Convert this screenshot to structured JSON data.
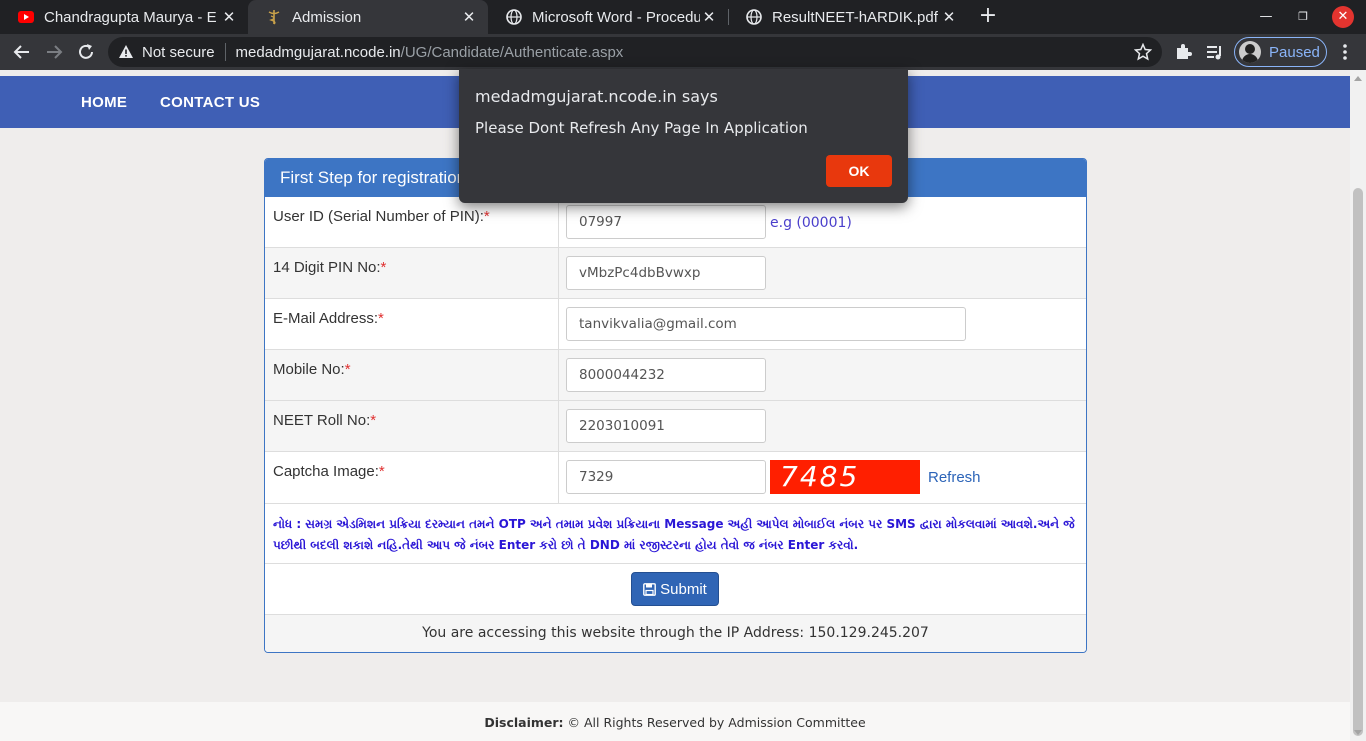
{
  "browser": {
    "tabs": [
      {
        "title": "Chandragupta Maurya - E",
        "icon": "youtube-icon"
      },
      {
        "title": "Admission",
        "icon": "caduceus-icon"
      },
      {
        "title": "Microsoft Word - Procedu",
        "icon": "globe-icon"
      },
      {
        "title": "ResultNEET-hARDIK.pdf",
        "icon": "globe-icon"
      }
    ],
    "active_tab_index": 1,
    "address": {
      "security_label": "Not secure",
      "host": "medadmgujarat.ncode.in",
      "path": "/UG/Candidate/Authenticate.aspx"
    },
    "profile_label": "Paused"
  },
  "nav": {
    "home": "HOME",
    "contact": "CONTACT US"
  },
  "form": {
    "heading": "First Step for registration",
    "required_mark": "*",
    "fields": [
      {
        "label": "User ID (Serial Number of PIN):",
        "value": "07997",
        "hint": "e.g (00001)"
      },
      {
        "label": "14 Digit PIN No:",
        "value": "vMbzPc4dbBvwxp"
      },
      {
        "label": "E-Mail Address:",
        "value": "tanvikvalia@gmail.com"
      },
      {
        "label": "Mobile No:",
        "value": "8000044232"
      },
      {
        "label": "NEET Roll No:",
        "value": "2203010091"
      },
      {
        "label": "Captcha Image:",
        "value": "7329",
        "captcha_text": "7485",
        "refresh_label": "Refresh"
      }
    ],
    "note": "નોધ : સમગ્ર એડમિશન પ્રક્રિયા દરમ્યાન તમને OTP અને તમામ પ્રવેશ પ્રક્રિયાના Message અહી આપેલ મોબાઈલ નંબર પર SMS દ્વારા મોકલવામાં આવશે.અને જે પછીથી બદલી શકાશે નહિ.તેથી આપ જે નંબર Enter કરો છો તે DND માં રજીસ્ટરના હોય તેવો જ નંબર Enter કરવો.",
    "submit_label": "Submit",
    "ip_text": "You are accessing this website through the IP Address: 150.129.245.207"
  },
  "footer": {
    "bold": "Disclaimer:",
    "text": " © All Rights Reserved by Admission Committee"
  },
  "dialog": {
    "title": "medadmgujarat.ncode.in says",
    "message": "Please Dont Refresh Any Page In Application",
    "ok_label": "OK"
  },
  "colors": {
    "navbar": "#3f5fb5",
    "panel_header": "#3d75c4",
    "captcha_bg": "#ff1f00",
    "ok_button": "#e8380d",
    "note_text": "#2a16d6"
  }
}
